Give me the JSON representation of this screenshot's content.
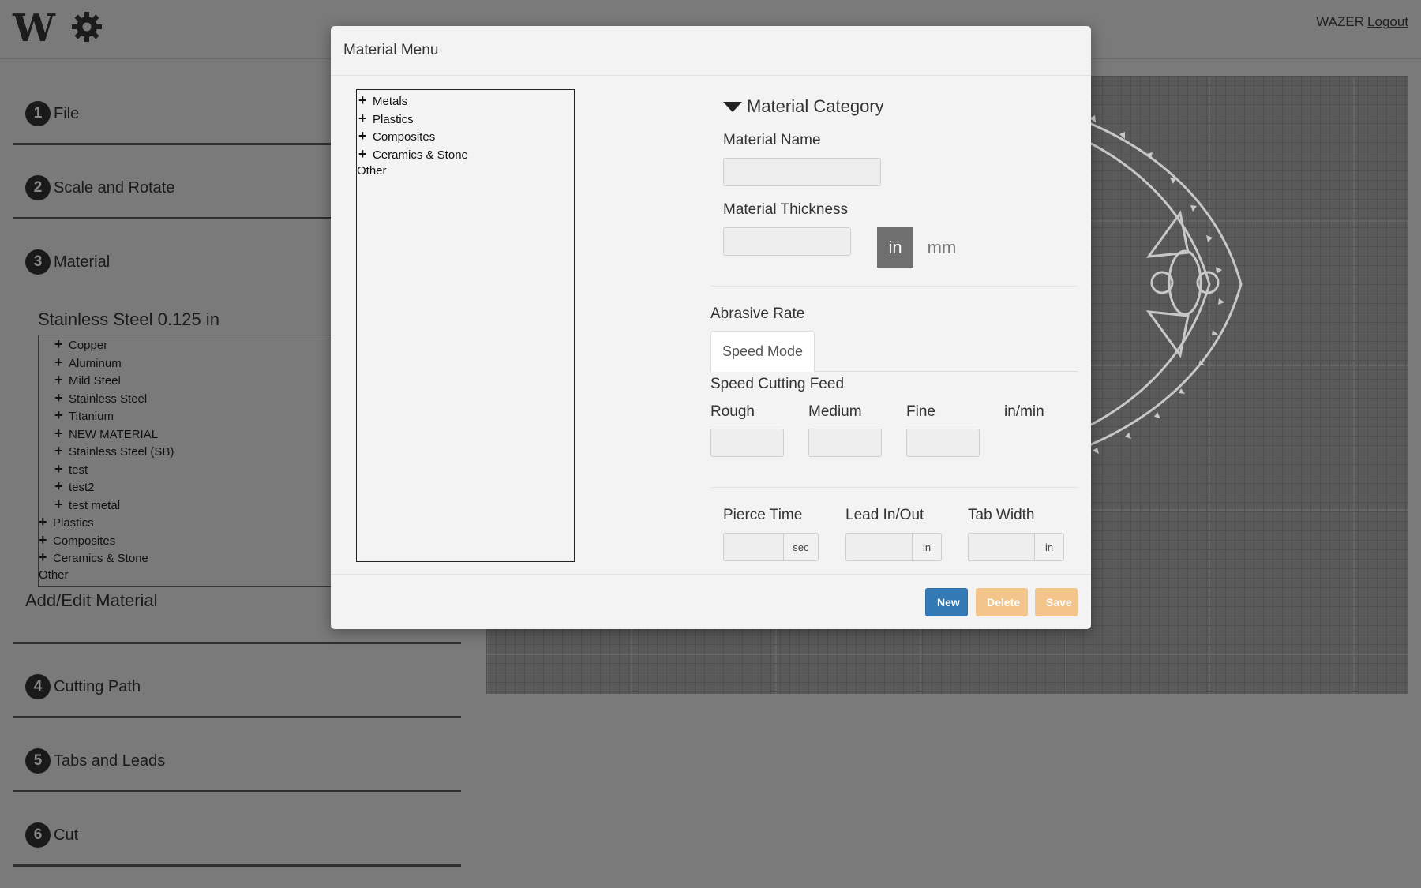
{
  "app": {
    "logo_text": "W",
    "user": "WAZER",
    "logout_label": "Logout"
  },
  "sidebar": {
    "steps": [
      {
        "num": "1",
        "label": "File"
      },
      {
        "num": "2",
        "label": "Scale and Rotate"
      },
      {
        "num": "3",
        "label": "Material"
      },
      {
        "num": "4",
        "label": "Cutting Path"
      },
      {
        "num": "5",
        "label": "Tabs and Leads"
      },
      {
        "num": "6",
        "label": "Cut"
      }
    ],
    "selected_material": "Stainless Steel 0.125 in",
    "tree": [
      {
        "label": "Copper",
        "expander": "+",
        "level": 1
      },
      {
        "label": "Aluminum",
        "expander": "+",
        "level": 1
      },
      {
        "label": "Mild Steel",
        "expander": "+",
        "level": 1
      },
      {
        "label": "Stainless Steel",
        "expander": "+",
        "level": 1
      },
      {
        "label": "Titanium",
        "expander": "+",
        "level": 1
      },
      {
        "label": "NEW MATERIAL",
        "expander": "+",
        "level": 1
      },
      {
        "label": "Stainless Steel (SB)",
        "expander": "+",
        "level": 1
      },
      {
        "label": "test",
        "expander": "+",
        "level": 1
      },
      {
        "label": "test2",
        "expander": "+",
        "level": 1
      },
      {
        "label": "test metal",
        "expander": "+",
        "level": 1
      },
      {
        "label": "Plastics",
        "expander": "+",
        "level": 0
      },
      {
        "label": "Composites",
        "expander": "+",
        "level": 0
      },
      {
        "label": "Ceramics & Stone",
        "expander": "+",
        "level": 0
      },
      {
        "label": "Other",
        "expander": "",
        "level": 0
      }
    ],
    "add_edit_label": "Add/Edit Material"
  },
  "modal": {
    "title": "Material Menu",
    "tree": [
      {
        "label": "Metals",
        "expander": "+"
      },
      {
        "label": "Plastics",
        "expander": "+"
      },
      {
        "label": "Composites",
        "expander": "+"
      },
      {
        "label": "Ceramics & Stone",
        "expander": "+"
      },
      {
        "label": "Other",
        "expander": ""
      }
    ],
    "category_label": "Material Category",
    "name_label": "Material Name",
    "name_value": "",
    "thickness_label": "Material Thickness",
    "thickness_value": "",
    "unit_in": "in",
    "unit_mm": "mm",
    "abrasive_label": "Abrasive Rate",
    "tab_speed": "Speed Mode",
    "speed_feed_label": "Speed Cutting Feed",
    "rough_label": "Rough",
    "medium_label": "Medium",
    "fine_label": "Fine",
    "feed_unit": "in/min",
    "pierce_label": "Pierce Time",
    "pierce_unit": "sec",
    "lead_label": "Lead In/Out",
    "lead_unit": "in",
    "tab_width_label": "Tab Width",
    "tab_width_unit": "in",
    "btn_new": "New",
    "btn_delete": "Delete",
    "btn_save": "Save"
  },
  "colors": {
    "primary": "#337ab7",
    "warning_disabled": "#f3c58a",
    "overlay": "#7a7a7a"
  }
}
